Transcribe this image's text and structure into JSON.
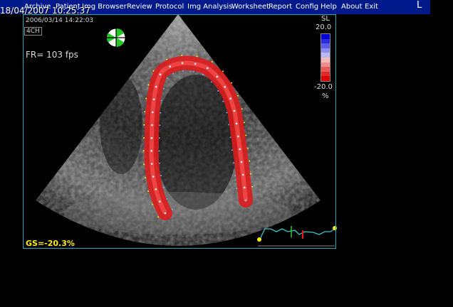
{
  "window": {
    "corner_label": "L"
  },
  "timestamp": "18/04/2007  10:25:37",
  "menu": [
    {
      "id": "archive",
      "label": "Archive"
    },
    {
      "id": "patient",
      "label": "Patient"
    },
    {
      "id": "img-browser",
      "label": "Img Browser"
    },
    {
      "id": "review",
      "label": "Review"
    },
    {
      "id": "protocol",
      "label": "Protocol"
    },
    {
      "id": "img-analysis",
      "label": "Img Analysis"
    },
    {
      "id": "worksheet",
      "label": "Worksheet"
    },
    {
      "id": "report",
      "label": "Report"
    },
    {
      "id": "config",
      "label": "Config"
    },
    {
      "id": "help",
      "label": "Help"
    },
    {
      "id": "about",
      "label": "About"
    },
    {
      "id": "exit",
      "label": "Exit"
    }
  ],
  "image_info": {
    "acq_datetime": "2006/03/14 14:22:03",
    "view": "4CH",
    "frame_rate": "FR= 103 fps",
    "global_strain": "GS=-20.3%"
  },
  "scale": {
    "title": "SL",
    "max": "20.0",
    "min": "-20.0",
    "unit": "%",
    "colors": [
      "#0000d8",
      "#2a2ae0",
      "#5a5ae8",
      "#8c8cef",
      "#b8b8f3",
      "#f3b8b8",
      "#ef8c8c",
      "#e85a5a",
      "#e02a2a",
      "#d80000"
    ]
  },
  "colors": {
    "menubar": "#001a8c",
    "border": "#2ca6b6",
    "strain_band": "#e01a1a",
    "gs_text": "#ffee00",
    "ecg": "#34c8c8"
  }
}
